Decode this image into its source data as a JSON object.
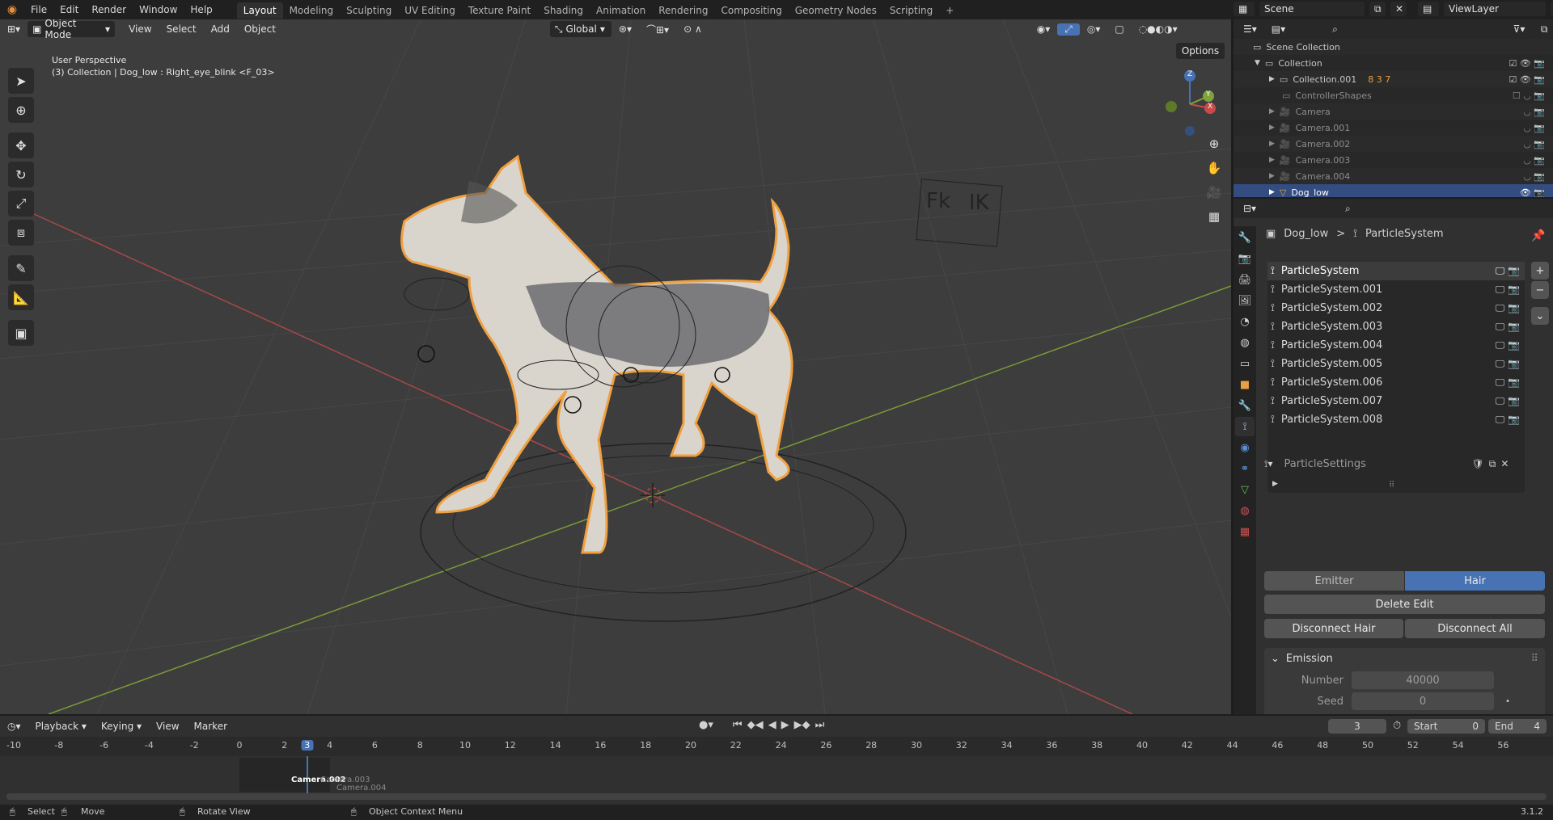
{
  "app": {
    "menus": [
      "File",
      "Edit",
      "Render",
      "Window",
      "Help"
    ],
    "workspace_tabs": [
      "Layout",
      "Modeling",
      "Sculpting",
      "UV Editing",
      "Texture Paint",
      "Shading",
      "Animation",
      "Rendering",
      "Compositing",
      "Geometry Nodes",
      "Scripting"
    ],
    "active_tab": "Layout",
    "add_tab": "+",
    "scene": "Scene",
    "view_layer": "ViewLayer"
  },
  "viewport": {
    "mode": "Object Mode",
    "menus": [
      "View",
      "Select",
      "Add",
      "Object"
    ],
    "transform_orientation": "Global",
    "options_label": "Options",
    "overlay_title": "User Perspective",
    "overlay_subtitle": "(3) Collection | Dog_low : Right_eye_blink <F_03>",
    "rig_label_fk": "Fk",
    "rig_label_ik": "IK",
    "gizmo_axes": {
      "x": "X",
      "y": "Y",
      "z": "Z"
    }
  },
  "outliner": {
    "rows": [
      {
        "label": "Scene Collection",
        "indent": 0,
        "icon": "collection-icon"
      },
      {
        "label": "Collection",
        "indent": 1,
        "icon": "collection-icon"
      },
      {
        "label": "Collection.001",
        "indent": 2,
        "icon": "collection-icon",
        "badges": "8 3 7"
      },
      {
        "label": "ControllerShapes",
        "indent": 2,
        "icon": "collection-icon"
      },
      {
        "label": "Camera",
        "indent": 2,
        "icon": "camera-icon"
      },
      {
        "label": "Camera.001",
        "indent": 2,
        "icon": "camera-icon"
      },
      {
        "label": "Camera.002",
        "indent": 2,
        "icon": "camera-icon"
      },
      {
        "label": "Camera.003",
        "indent": 2,
        "icon": "camera-icon"
      },
      {
        "label": "Camera.004",
        "indent": 2,
        "icon": "camera-icon"
      },
      {
        "label": "Dog_low",
        "indent": 2,
        "icon": "mesh-icon",
        "selected": true
      }
    ]
  },
  "properties": {
    "breadcrumb_object": "Dog_low",
    "breadcrumb_separator": ">",
    "breadcrumb_data": "ParticleSystem",
    "particle_systems": [
      "ParticleSystem",
      "ParticleSystem.001",
      "ParticleSystem.002",
      "ParticleSystem.003",
      "ParticleSystem.004",
      "ParticleSystem.005",
      "ParticleSystem.006",
      "ParticleSystem.007",
      "ParticleSystem.008"
    ],
    "active_system": "ParticleSystem",
    "settings_name": "ParticleSettings",
    "type_emitter": "Emitter",
    "type_hair": "Hair",
    "active_type": "Hair",
    "delete_edit": "Delete Edit",
    "disconnect_hair": "Disconnect Hair",
    "disconnect_all": "Disconnect All",
    "emission_panel": "Emission",
    "number_label": "Number",
    "number_value": "40000",
    "seed_label": "Seed",
    "seed_value": "0"
  },
  "timeline": {
    "menus": [
      "Playback",
      "Keying",
      "View",
      "Marker"
    ],
    "current_frame": "3",
    "start_label": "Start",
    "start_value": "0",
    "end_label": "End",
    "end_value": "4",
    "ticks": [
      "-10",
      "-8",
      "-6",
      "-4",
      "-2",
      "0",
      "2",
      "3",
      "4",
      "6",
      "8",
      "10",
      "12",
      "14",
      "16",
      "18",
      "20",
      "22",
      "24",
      "26",
      "28",
      "30",
      "32",
      "34",
      "36",
      "38",
      "40",
      "42",
      "44",
      "46",
      "48",
      "50",
      "52",
      "54",
      "56"
    ],
    "marker_labels": [
      "Camera.002",
      "Camera.003",
      "Camera.004"
    ]
  },
  "statusbar": {
    "select": "Select",
    "move": "Move",
    "rotate": "Rotate View",
    "context_menu": "Object Context Menu",
    "version": "3.1.2"
  },
  "colors": {
    "accent": "#4772b3",
    "selection_outline": "#f0a040",
    "x_axis": "#b94a4a",
    "y_axis": "#7ea33a",
    "panel_bg": "#303030"
  }
}
